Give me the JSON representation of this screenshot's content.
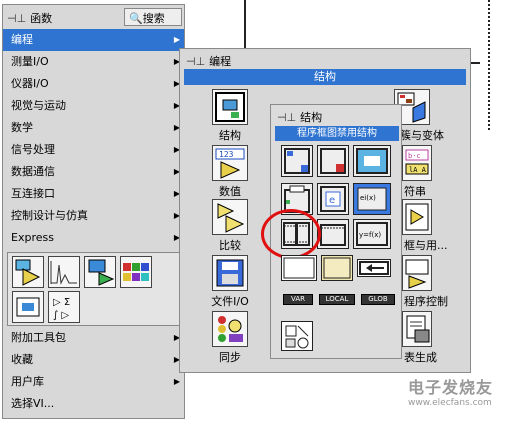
{
  "palette1": {
    "title": "函数",
    "search_label": "搜索",
    "items": [
      {
        "label": "编程",
        "arrow": "▶"
      },
      {
        "label": "测量I/O",
        "arrow": "▶"
      },
      {
        "label": "仪器I/O",
        "arrow": "▶"
      },
      {
        "label": "视觉与运动",
        "arrow": "▶"
      },
      {
        "label": "数学",
        "arrow": "▶"
      },
      {
        "label": "信号处理",
        "arrow": "▶"
      },
      {
        "label": "数据通信",
        "arrow": "▶"
      },
      {
        "label": "互连接口",
        "arrow": "▶"
      },
      {
        "label": "控制设计与仿真",
        "arrow": "▶"
      },
      {
        "label": "Express",
        "arrow": "▶"
      }
    ],
    "bottom_items": [
      {
        "label": "附加工具包",
        "arrow": "▶"
      },
      {
        "label": "收藏",
        "arrow": "▶"
      },
      {
        "label": "用户库",
        "arrow": "▶"
      },
      {
        "label": "选择VI...",
        "arrow": ""
      }
    ]
  },
  "palette2": {
    "title": "编程",
    "bar": "结构",
    "labels": [
      "结构",
      "数值",
      "比较",
      "文件I/O",
      "同步"
    ],
    "right_labels": [
      "簇与变体",
      "符串",
      "框与用...",
      "程序控制",
      "表生成"
    ]
  },
  "palette3": {
    "title": "结构",
    "bar": "程序框图禁用结构",
    "bottom_buttons": [
      "VAR",
      "LOCAL",
      "GLOB"
    ],
    "mathscript_label": "ei(x)",
    "formula_label": "y=f(x)"
  },
  "colors": {
    "selection": "#2f74d0",
    "highlight_ring": "#e01010"
  },
  "watermark": {
    "line1": "电子发烧友",
    "line2": "www.elecfans.com"
  }
}
